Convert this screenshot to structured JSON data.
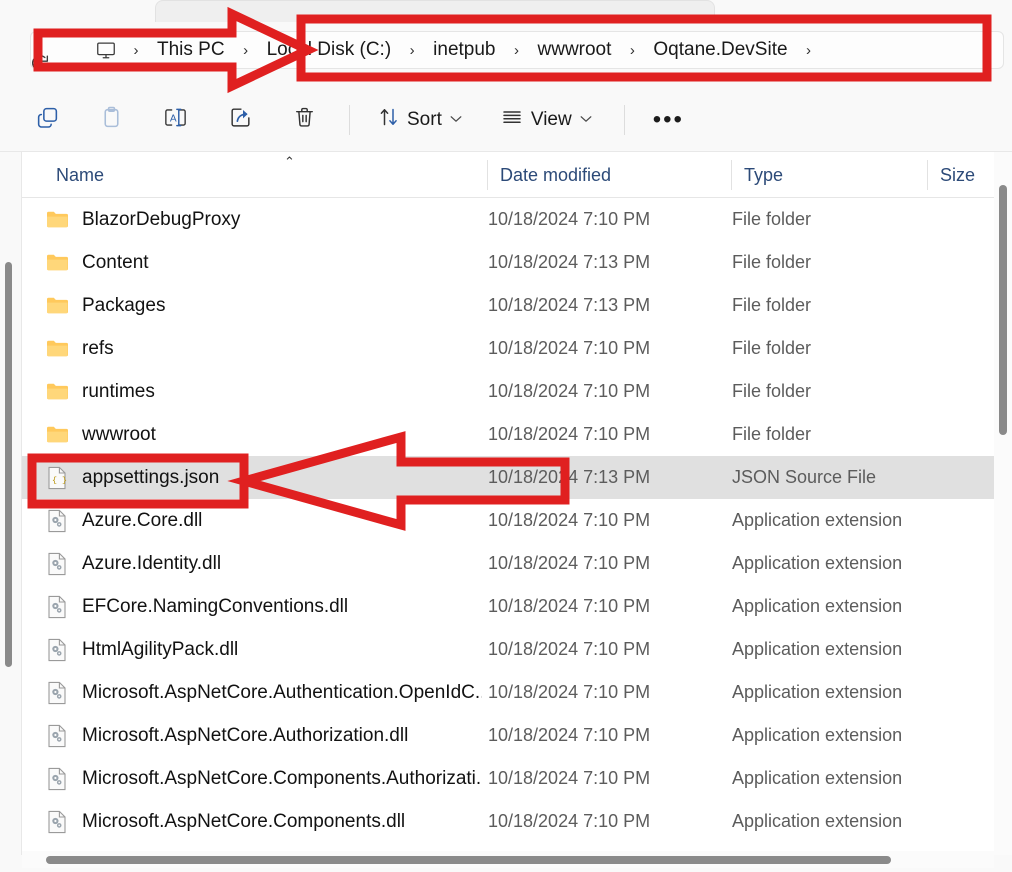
{
  "window": {
    "app": "File Explorer",
    "accent_annotation_color": "#E02020",
    "selection_color": "#E0E0E0"
  },
  "address_bar": {
    "refresh_icon": "refresh-icon",
    "root_icon": "this-pc-monitor-icon",
    "separator": "›",
    "breadcrumbs": [
      {
        "label": "This PC",
        "icon": "this-pc-monitor-icon"
      },
      {
        "label": "Local Disk (C:)",
        "icon": ""
      },
      {
        "label": "inetpub",
        "icon": ""
      },
      {
        "label": "wwwroot",
        "icon": ""
      },
      {
        "label": "Oqtane.DevSite",
        "icon": ""
      }
    ],
    "trailing_separator": "›"
  },
  "command_bar": {
    "buttons": [
      {
        "name": "copy-button",
        "icon": "copy-icon",
        "label": "",
        "disabled": false
      },
      {
        "name": "paste-button",
        "icon": "paste-icon",
        "label": "",
        "disabled": true
      },
      {
        "name": "rename-button",
        "icon": "rename-icon",
        "label": "",
        "disabled": false
      },
      {
        "name": "share-button",
        "icon": "share-icon",
        "label": "",
        "disabled": false
      },
      {
        "name": "delete-button",
        "icon": "trash-icon",
        "label": "",
        "disabled": false
      }
    ],
    "sort": {
      "label": "Sort",
      "icon": "sort-arrows-icon",
      "chevron": "⌄"
    },
    "view": {
      "label": "View",
      "icon": "view-list-icon",
      "chevron": "⌄"
    },
    "overflow": {
      "label": "•••",
      "name": "see-more-button"
    }
  },
  "columns": {
    "name": "Name",
    "date_modified": "Date modified",
    "type": "Type",
    "size": "Size",
    "sort_indicator": "⌃",
    "sorted_by": "Name",
    "sort_direction": "ascending"
  },
  "files": [
    {
      "name": "BlazorDebugProxy",
      "date": "10/18/2024 7:10 PM",
      "type": "File folder",
      "size": "",
      "icon": "folder-icon",
      "selected": false
    },
    {
      "name": "Content",
      "date": "10/18/2024 7:13 PM",
      "type": "File folder",
      "size": "",
      "icon": "folder-icon",
      "selected": false
    },
    {
      "name": "Packages",
      "date": "10/18/2024 7:13 PM",
      "type": "File folder",
      "size": "",
      "icon": "folder-icon",
      "selected": false
    },
    {
      "name": "refs",
      "date": "10/18/2024 7:10 PM",
      "type": "File folder",
      "size": "",
      "icon": "folder-icon",
      "selected": false
    },
    {
      "name": "runtimes",
      "date": "10/18/2024 7:10 PM",
      "type": "File folder",
      "size": "",
      "icon": "folder-icon",
      "selected": false
    },
    {
      "name": "wwwroot",
      "date": "10/18/2024 7:10 PM",
      "type": "File folder",
      "size": "",
      "icon": "folder-icon",
      "selected": false
    },
    {
      "name": "appsettings.json",
      "date": "10/18/2024 7:13 PM",
      "type": "JSON Source File",
      "size": "",
      "icon": "json-file-icon",
      "selected": true
    },
    {
      "name": "Azure.Core.dll",
      "date": "10/18/2024 7:10 PM",
      "type": "Application extension",
      "size": "",
      "icon": "dll-file-icon",
      "selected": false
    },
    {
      "name": "Azure.Identity.dll",
      "date": "10/18/2024 7:10 PM",
      "type": "Application extension",
      "size": "",
      "icon": "dll-file-icon",
      "selected": false
    },
    {
      "name": "EFCore.NamingConventions.dll",
      "date": "10/18/2024 7:10 PM",
      "type": "Application extension",
      "size": "",
      "icon": "dll-file-icon",
      "selected": false
    },
    {
      "name": "HtmlAgilityPack.dll",
      "date": "10/18/2024 7:10 PM",
      "type": "Application extension",
      "size": "",
      "icon": "dll-file-icon",
      "selected": false
    },
    {
      "name": "Microsoft.AspNetCore.Authentication.OpenIdC...",
      "date": "10/18/2024 7:10 PM",
      "type": "Application extension",
      "size": "",
      "icon": "dll-file-icon",
      "selected": false
    },
    {
      "name": "Microsoft.AspNetCore.Authorization.dll",
      "date": "10/18/2024 7:10 PM",
      "type": "Application extension",
      "size": "",
      "icon": "dll-file-icon",
      "selected": false
    },
    {
      "name": "Microsoft.AspNetCore.Components.Authorizati...",
      "date": "10/18/2024 7:10 PM",
      "type": "Application extension",
      "size": "",
      "icon": "dll-file-icon",
      "selected": false
    },
    {
      "name": "Microsoft.AspNetCore.Components.dll",
      "date": "10/18/2024 7:10 PM",
      "type": "Application extension",
      "size": "",
      "icon": "dll-file-icon",
      "selected": false
    }
  ],
  "annotations": [
    {
      "name": "breadcrumb-highlight-box",
      "shape": "rectangle",
      "target": "Local Disk (C:) › inetpub › wwwroot › Oqtane.DevSite ›"
    },
    {
      "name": "breadcrumb-pointer-arrow",
      "shape": "arrow-right",
      "target": "address bar path"
    },
    {
      "name": "appsettings-highlight-box",
      "shape": "rectangle",
      "target": "appsettings.json"
    },
    {
      "name": "appsettings-pointer-arrow",
      "shape": "arrow-left",
      "target": "appsettings.json"
    }
  ]
}
